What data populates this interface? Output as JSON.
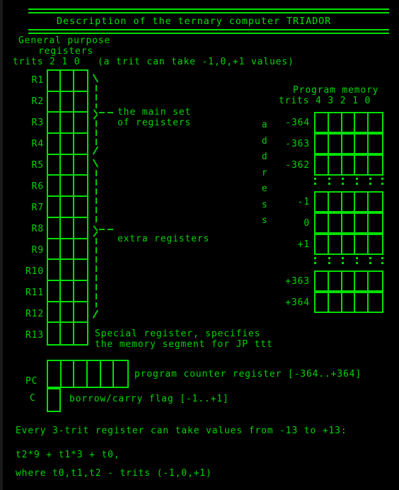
{
  "title": "Description of the ternary computer TRIADOR",
  "sections": {
    "general_registers": {
      "heading_line1": "General purpose",
      "heading_line2": "registers",
      "trits_label": "trits 2 1 0",
      "trit_note": "(a trit can take -1,0,+1 values)",
      "trit_columns": [
        "2",
        "1",
        "0"
      ],
      "registers": [
        "R1",
        "R2",
        "R3",
        "R4",
        "R5",
        "R6",
        "R7",
        "R8",
        "R9",
        "R10",
        "R11",
        "R12",
        "R13"
      ],
      "main_set_label_line1": "the main set",
      "main_set_label_line2": "of registers",
      "main_set_range": [
        "R1",
        "R4"
      ],
      "extra_label": "extra registers",
      "extra_range": [
        "R5",
        "R12"
      ],
      "r13_note_line1": "Special register, specifies",
      "r13_note_line2": "the memory segment for JP ttt"
    },
    "program_memory": {
      "heading": "Program memory",
      "trits_label": "trits 4 3 2 1 0",
      "trit_columns": [
        "4",
        "3",
        "2",
        "1",
        "0"
      ],
      "address_word": "address",
      "address_letters": [
        "a",
        "d",
        "d",
        "r",
        "e",
        "s",
        "s"
      ],
      "addresses": [
        "-364",
        "-363",
        "-362",
        "",
        "-1",
        "0",
        "+1",
        "",
        "+363",
        "+364"
      ],
      "ellipsis_rows": [
        3,
        7
      ]
    },
    "pc": {
      "label": "PC",
      "cells": 6,
      "description": "program counter register [-364..+364]"
    },
    "carry": {
      "label": "C",
      "cells": 1,
      "description": "borrow/carry flag [-1..+1]"
    },
    "footer": {
      "line1": "Every 3-trit register can take values from -13 to +13:",
      "line2": "t2*9 + t1*3 + t0,",
      "line3": "where t0,t1,t2 - trits (-1,0,+1)"
    }
  },
  "colors": {
    "background": "#000000",
    "foreground": "#00d400",
    "bright": "#00e000",
    "frame": "#1a1a1a"
  }
}
